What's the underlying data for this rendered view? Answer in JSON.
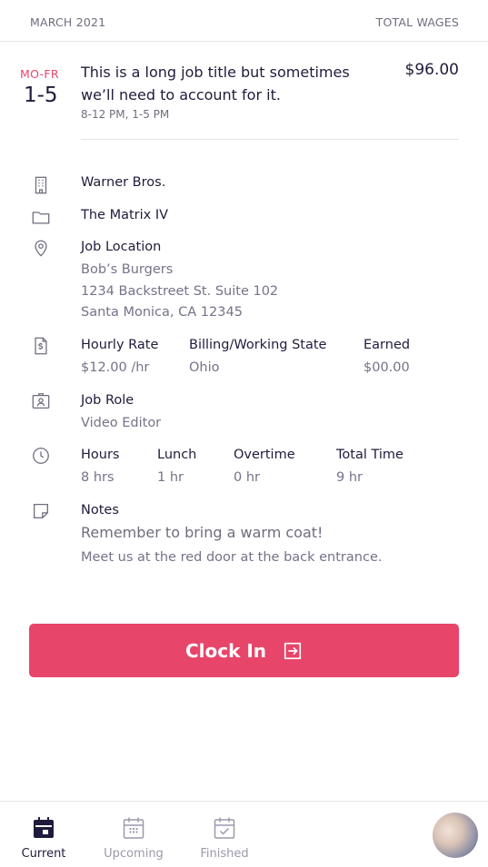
{
  "header": {
    "month": "MARCH 2021",
    "total_wages_label": "TOTAL WAGES"
  },
  "job": {
    "days": "MO-FR",
    "range": "1-5",
    "title": "This is a long job title but sometimes we’ll need to account for it.",
    "times": "8-12 PM, 1-5 PM",
    "price": "$96.00"
  },
  "details": {
    "company": "Warner Bros.",
    "project": "The Matrix IV",
    "location": {
      "label": "Job Location",
      "line1": "Bob’s Burgers",
      "line2": "1234 Backstreet St. Suite 102",
      "line3": "Santa Monica, CA 12345"
    },
    "rates": {
      "hourly_label": "Hourly Rate",
      "hourly_value": "$12.00 /hr",
      "state_label": "Billing/Working State",
      "state_value": "Ohio",
      "earned_label": "Earned",
      "earned_value": "$00.00"
    },
    "role": {
      "label": "Job Role",
      "value": "Video Editor"
    },
    "hours": {
      "hours_label": "Hours",
      "hours_value": "8 hrs",
      "lunch_label": "Lunch",
      "lunch_value": "1 hr",
      "overtime_label": "Overtime",
      "overtime_value": "0 hr",
      "total_label": "Total Time",
      "total_value": "9 hr"
    },
    "notes": {
      "label": "Notes",
      "headline": "Remember to bring a warm coat!",
      "body": "Meet us at the red door at the back entrance."
    }
  },
  "cta": {
    "label": "Clock In"
  },
  "tabs": [
    {
      "label": "Current",
      "icon": "calendar-filled-icon",
      "active": true
    },
    {
      "label": "Upcoming",
      "icon": "calendar-grid-icon",
      "active": false
    },
    {
      "label": "Finished",
      "icon": "calendar-check-icon",
      "active": false
    }
  ],
  "colors": {
    "accent": "#e8456a",
    "text": "#1f1c3b",
    "muted": "#74738a",
    "tab_active": "#1f1c3b",
    "tab_inactive": "#9a99ab"
  }
}
